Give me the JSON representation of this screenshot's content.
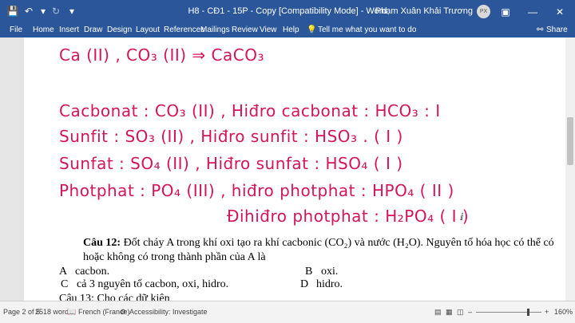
{
  "window": {
    "title": "H8 - CĐ1 - 15P - Copy [Compatibility Mode] - Word",
    "user": "Phạm Xuân Khải Trương",
    "avatar_initials": "PX"
  },
  "quick_access": {
    "save_icon": "save-icon",
    "undo_icon": "undo-icon",
    "redo_icon": "redo-icon"
  },
  "menu": {
    "items": [
      "File",
      "Home",
      "Insert",
      "Draw",
      "Design",
      "Layout",
      "References",
      "Mailings",
      "Review",
      "View",
      "Help"
    ],
    "tell_me": "Tell me what you want to do",
    "share": "Share"
  },
  "document": {
    "handwriting": [
      "Ca (II) , CO₃ (II) ⇒ CaCO₃",
      "Cacbonat : CO₃ (II) ,   Hiđro cacbonat : HCO₃ : I",
      "Sunfit :  SO₃ (II) ,   Hiđro sunfit :  HSO₃ . ( I )",
      "Sunfat :  SO₄ (II) ,   Hiđro sunfat : HSO₄ ( I )",
      "Photphat :  PO₄ (III) ,   hiđro photphat :  HPO₄  ( II )",
      "Đihiđro photphat :  H₂PO₄ ( I )"
    ],
    "question_label": "Câu 12:",
    "question_line1": " Đốt cháy A trong khí oxi tạo ra khí cacbonic (CO₂) và nước (H₂O). Nguyên tố hóa học có thể có",
    "question_line2": "hoặc không có trong thành phần của A là",
    "options": {
      "a_letter": "A",
      "a_text": "cacbon.",
      "b_letter": "B",
      "b_text": "oxi.",
      "c_letter": "C",
      "c_text": "cả 3 nguyên tố cacbon, oxi, hidro.",
      "d_letter": "D",
      "d_text": "hidro."
    },
    "next_question_partial": "Câu 13: Cho các dữ kiện"
  },
  "status": {
    "page": "Page 2 of 5",
    "words": "2518 words",
    "language": "French (France)",
    "accessibility": "Accessibility: Investigate",
    "zoom": "160%"
  }
}
